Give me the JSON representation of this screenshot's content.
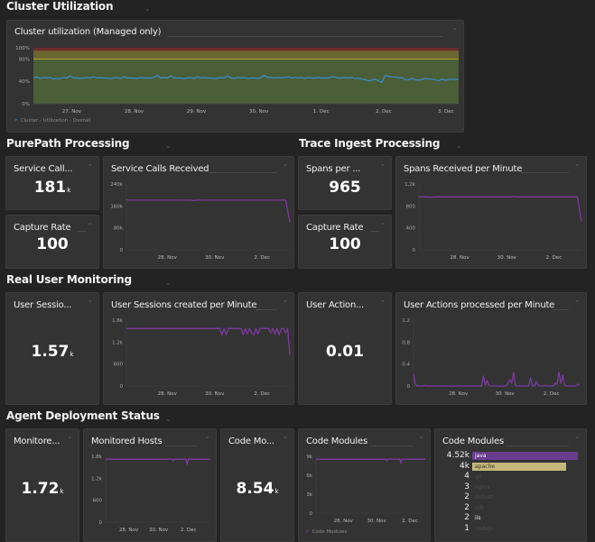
{
  "colors": {
    "background": "#222322",
    "tile": "#333333",
    "purple": "#7c3a9e",
    "blue": "#3a8fd0",
    "green_zone": "#4a5e38",
    "yellow_zone": "#6b6530",
    "red_zone": "#6e2a2a",
    "threshold_line": "#c8b820",
    "java_bar": "#6a3d8f",
    "apache_bar": "#c2b87a"
  },
  "sections": [
    {
      "id": "cluster",
      "title": "Cluster Utilization"
    },
    {
      "id": "purepath",
      "title": "PurePath Processing"
    },
    {
      "id": "trace",
      "title": "Trace Ingest Processing"
    },
    {
      "id": "rum",
      "title": "Real User Monitoring"
    },
    {
      "id": "agent",
      "title": "Agent Deployment Status"
    }
  ],
  "tiles": {
    "cluster_chart": {
      "title": "Cluster utilization (Managed only)",
      "legend": "Cluster - Utilization - Overall"
    },
    "service_calls_single": {
      "title": "Service Call...",
      "value": "181",
      "unit": "k"
    },
    "capture_rate_pp": {
      "title": "Capture Rate",
      "value": "100",
      "unit": ""
    },
    "service_calls_chart": {
      "title": "Service Calls Received"
    },
    "spans_single": {
      "title": "Spans per ...",
      "value": "965",
      "unit": ""
    },
    "capture_rate_trace": {
      "title": "Capture Rate",
      "value": "100",
      "unit": ""
    },
    "spans_chart": {
      "title": "Spans Received per Minute"
    },
    "user_sessions_single": {
      "title": "User Sessio...",
      "value": "1.57",
      "unit": "k"
    },
    "user_sessions_chart": {
      "title": "User Sessions created per Minute"
    },
    "user_actions_single": {
      "title": "User Action...",
      "value": "0.01",
      "unit": ""
    },
    "user_actions_chart": {
      "title": "User Actions processed per Minute"
    },
    "monitored_single": {
      "title": "Monitore...",
      "value": "1.72",
      "unit": "k"
    },
    "monitored_hosts_chart": {
      "title": "Monitored Hosts"
    },
    "code_modules_single": {
      "title": "Code Mo...",
      "value": "8.54",
      "unit": "k"
    },
    "code_modules_chart": {
      "title": "Code Modules",
      "legend": "Code Modules"
    },
    "code_modules_topn": {
      "title": "Code Modules",
      "rows": [
        {
          "value": "4.52k",
          "name": "java",
          "share": 1.0
        },
        {
          "value": "4k",
          "name": "apache",
          "share": 0.885
        },
        {
          "value": "4",
          "name": "go",
          "share": 0
        },
        {
          "value": "3",
          "name": "nginx",
          "share": 0
        },
        {
          "value": "2",
          "name": "dotnet",
          "share": 0
        },
        {
          "value": "2",
          "name": "sdk",
          "share": 0
        },
        {
          "value": "2",
          "name": "iis",
          "share": 0
        },
        {
          "value": "1",
          "name": "nodejs",
          "share": 0
        }
      ]
    }
  },
  "chart_data": [
    {
      "id": "cluster",
      "type": "line",
      "title": "Cluster utilization (Managed only)",
      "y_ticks": [
        "0%",
        "40%",
        "80%",
        "100%"
      ],
      "ylim": [
        0,
        100
      ],
      "x_ticks": [
        "27. Nov",
        "28. Nov",
        "29. Nov",
        "30. Nov",
        "1. Dec",
        "2. Dec",
        "3. Dec"
      ],
      "thresholds": {
        "warning": 80,
        "critical": 95
      },
      "series": [
        {
          "name": "Cluster - Utilization - Overall",
          "values": [
            46,
            48,
            45,
            47,
            46,
            47,
            44,
            45,
            45,
            47,
            46,
            50,
            46,
            46,
            45,
            46,
            47,
            46,
            48,
            46,
            47,
            46,
            46,
            45,
            46,
            47,
            45,
            48,
            46,
            46,
            46,
            45,
            47,
            46,
            46,
            46,
            47,
            51,
            46,
            47,
            46,
            50,
            46,
            46,
            46,
            45,
            46,
            47,
            45,
            48,
            46,
            47,
            46,
            46,
            45,
            46,
            47,
            46,
            50,
            46,
            45,
            47,
            46,
            47,
            45,
            46,
            46,
            45,
            47,
            51,
            47,
            47,
            46,
            47,
            46,
            47,
            48,
            46,
            47,
            46,
            47,
            45,
            47,
            46,
            46,
            47,
            46,
            46,
            46,
            48,
            48,
            46,
            46,
            47,
            46,
            47,
            45,
            46,
            44,
            43,
            41,
            42,
            44,
            41,
            38,
            50,
            49,
            48,
            48,
            46,
            47,
            43,
            43,
            45,
            43,
            42,
            43,
            45,
            44,
            44,
            43,
            41,
            44,
            42,
            43,
            44,
            43,
            44
          ]
        }
      ]
    },
    {
      "id": "service_calls",
      "type": "line",
      "title": "Service Calls Received",
      "y_ticks": [
        "0",
        "80k",
        "160k",
        "240k"
      ],
      "ylim": [
        0,
        240000
      ],
      "x_ticks": [
        "28. Nov",
        "30. Nov",
        "2. Dec"
      ],
      "series": [
        {
          "name": "Service Calls Received",
          "values": [
            181000,
            181000,
            181000,
            181000,
            181000,
            181000,
            181000,
            181000,
            181000,
            181000,
            181000,
            181000,
            181000,
            181000,
            181000,
            181000,
            180000,
            181000,
            181000,
            181000,
            181000,
            181000,
            181000,
            181000,
            181000,
            181000,
            181000,
            181000,
            181000,
            181000,
            181000,
            181000,
            181000,
            181000,
            181000,
            181000,
            181000,
            181000,
            181000,
            100000
          ]
        }
      ]
    },
    {
      "id": "spans",
      "type": "line",
      "title": "Spans Received per Minute",
      "y_ticks": [
        "0",
        "400",
        "800",
        "1.2k"
      ],
      "ylim": [
        0,
        1200
      ],
      "x_ticks": [
        "28. Nov",
        "30. Nov",
        "2. Dec"
      ],
      "series": [
        {
          "name": "Spans Received per Minute",
          "values": [
            965,
            965,
            965,
            960,
            965,
            965,
            965,
            965,
            965,
            965,
            965,
            965,
            965,
            965,
            965,
            965,
            965,
            965,
            965,
            965,
            965,
            965,
            965,
            975,
            965,
            965,
            965,
            965,
            965,
            965,
            965,
            965,
            965,
            965,
            965,
            965,
            965,
            965,
            965,
            520
          ]
        }
      ]
    },
    {
      "id": "user_sessions",
      "type": "line",
      "title": "User Sessions created per Minute",
      "y_ticks": [
        "0",
        "600",
        "1.2k",
        "1.8k"
      ],
      "ylim": [
        0,
        1800
      ],
      "x_ticks": [
        "28. Nov",
        "30. Nov",
        "2. Dec"
      ],
      "series": [
        {
          "name": "User Sessions created per Minute",
          "values": [
            1570,
            1570,
            1565,
            1570,
            1570,
            1570,
            1570,
            1570,
            1570,
            1570,
            1570,
            1570,
            1570,
            1570,
            1570,
            1570,
            1570,
            1570,
            1570,
            1575,
            1570,
            1570,
            1570,
            1570,
            1570,
            1570,
            1570,
            1570,
            1570,
            1570,
            1570,
            1570,
            1570,
            1570,
            1570,
            1570,
            1570,
            1570,
            1570,
            1570,
            1570,
            1570,
            1570,
            1570,
            1570,
            1400,
            1570,
            1400,
            1570,
            1570,
            1570,
            1570,
            1570,
            1570,
            1570,
            1400,
            1570,
            1420,
            1570,
            1450,
            1400,
            1570,
            1420,
            1570,
            1570,
            1570,
            1570,
            1570,
            1450,
            1570,
            1420,
            1570,
            1400,
            1570,
            1570,
            1450,
            1570,
            850
          ]
        }
      ]
    },
    {
      "id": "user_actions",
      "type": "line",
      "title": "User Actions processed per Minute",
      "y_ticks": [
        "0",
        "0.4",
        "0.8",
        "1.2"
      ],
      "ylim": [
        0,
        1.2
      ],
      "x_ticks": [
        "28. Nov",
        "30. Nov",
        "2. Dec"
      ],
      "series": [
        {
          "name": "User Actions processed per Minute",
          "values": [
            0.22,
            0.02,
            0,
            0,
            0,
            0,
            0.01,
            0,
            0,
            0,
            0,
            0,
            0,
            0,
            0,
            0,
            0,
            0,
            0,
            0,
            0,
            0,
            0,
            0,
            0,
            0,
            0,
            0,
            0,
            0,
            0,
            0,
            0,
            0,
            0,
            0,
            0,
            0.18,
            0.02,
            0.1,
            0.01,
            0,
            0,
            0,
            0,
            0,
            0,
            0,
            0,
            0,
            0.05,
            0.12,
            0.05,
            0.25,
            0.01,
            0,
            0,
            0,
            0,
            0,
            0,
            0,
            0.15,
            0.01,
            0,
            0.08,
            0.02,
            0,
            0,
            0,
            0.01,
            0,
            0,
            0,
            0,
            0.05,
            0.03,
            0.25,
            0.05,
            0.2,
            0.02,
            0,
            0,
            0,
            0,
            0,
            0,
            0.03,
            0.03
          ]
        }
      ]
    },
    {
      "id": "monitored_hosts",
      "type": "line",
      "title": "Monitored Hosts",
      "y_ticks": [
        "0",
        "600",
        "1.2k",
        "1.8k"
      ],
      "ylim": [
        0,
        1800
      ],
      "x_ticks": [
        "28. Nov",
        "30. Nov",
        "2. Dec"
      ],
      "series": [
        {
          "name": "Monitored Hosts",
          "values": [
            1720,
            1720,
            1720,
            1720,
            1720,
            1720,
            1720,
            1720,
            1720,
            1720,
            1720,
            1720,
            1720,
            1720,
            1720,
            1720,
            1720,
            1720,
            1720,
            1720,
            1720,
            1720,
            1720,
            1720,
            1720,
            1720,
            1720,
            1720,
            1720,
            1720,
            1720,
            1720,
            1720,
            1720,
            1720,
            1720,
            1720,
            1720,
            1720,
            1720,
            1720,
            1720,
            1720,
            1720,
            1720,
            1720,
            1720,
            1720,
            1720,
            1720,
            1720,
            1720,
            1720,
            1720,
            1720,
            1720,
            1720,
            1720,
            1720,
            1720,
            1720,
            1720,
            1720,
            1720,
            1680,
            1720,
            1720,
            1720,
            1720,
            1720,
            1720,
            1720,
            1720,
            1720,
            1720,
            1720,
            1720,
            1580,
            1720,
            1720,
            1720,
            1720,
            1720,
            1720,
            1720,
            1720,
            1720,
            1720,
            1720,
            1720,
            1720,
            1720,
            1720,
            1720,
            1720,
            1720,
            1720,
            1720,
            1720,
            1720
          ]
        }
      ]
    },
    {
      "id": "code_modules",
      "type": "line",
      "title": "Code Modules",
      "y_ticks": [
        "0",
        "3k",
        "6k",
        "9k"
      ],
      "ylim": [
        0,
        9000
      ],
      "x_ticks": [
        "28. Nov",
        "30. Nov",
        "2. Dec"
      ],
      "series": [
        {
          "name": "Code Modules",
          "values": [
            8540,
            8540,
            8540,
            8540,
            8540,
            8540,
            8540,
            8540,
            8540,
            8540,
            8540,
            8540,
            8540,
            8540,
            8540,
            8540,
            8540,
            8540,
            8540,
            8540,
            8540,
            8540,
            8540,
            8540,
            8540,
            8540,
            8540,
            8540,
            8540,
            8540,
            8540,
            8540,
            8540,
            8540,
            8540,
            8540,
            8540,
            8540,
            8540,
            8540,
            8540,
            8540,
            8540,
            8540,
            8540,
            8540,
            8540,
            8540,
            8540,
            8540,
            8540,
            8540,
            8540,
            8540,
            8540,
            8540,
            8540,
            8540,
            8540,
            8540,
            8540,
            8540,
            8540,
            8540,
            8300,
            8540,
            8540,
            8540,
            8540,
            8540,
            8540,
            8540,
            8540,
            8540,
            8540,
            8540,
            8540,
            7900,
            8540,
            8540,
            8540,
            8540,
            8540,
            8540,
            8540,
            8540,
            8540,
            8540,
            8540,
            8540,
            8540,
            8540,
            8540,
            8540,
            8540,
            8540,
            8540,
            8540,
            8540,
            8540
          ]
        }
      ]
    }
  ]
}
